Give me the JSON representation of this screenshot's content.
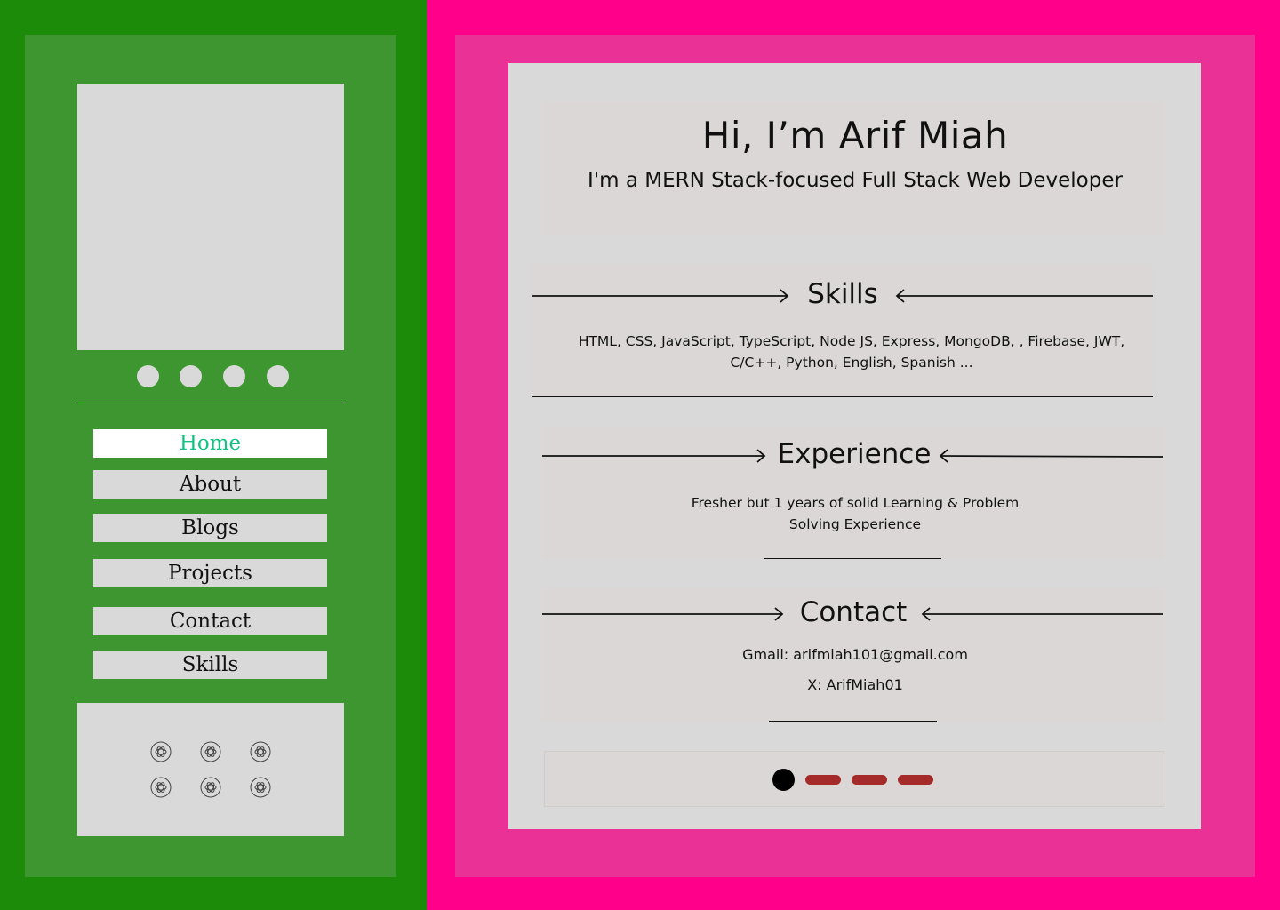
{
  "sidebar": {
    "nav_items": [
      {
        "label": "Home",
        "active": true
      },
      {
        "label": "About",
        "active": false
      },
      {
        "label": "Blogs",
        "active": false
      },
      {
        "label": "Projects",
        "active": false
      },
      {
        "label": "Contact",
        "active": false
      },
      {
        "label": "Skills",
        "active": false
      }
    ],
    "social_icon": "openai-knot-icon"
  },
  "hero": {
    "title": "Hi,  I’m Arif Miah",
    "subtitle": "I'm a MERN Stack-focused Full Stack Web Developer"
  },
  "skills": {
    "title": "Skills",
    "text_line1": "HTML, CSS, JavaScript, TypeScript, Node JS, Express, MongoDB, , Firebase, JWT,",
    "text_line2": "C/C++, Python, English, Spanish ..."
  },
  "experience": {
    "title": "Experience",
    "text_line1": "Fresher but 1 years of solid Learning & Problem",
    "text_line2": "Solving Experience"
  },
  "contact": {
    "title": "Contact",
    "gmail": "Gmail: arifmiah101@gmail.com",
    "x": "X: ArifMiah01"
  },
  "pager": {
    "pages": 4,
    "current": 1
  },
  "colors": {
    "left_bg": "#1c8b09",
    "left_panel": "#3d9630",
    "right_bg": "#ff008a",
    "right_panel": "#ea3196",
    "active_nav_text": "#13c283",
    "pager_inactive": "#a52a2a"
  }
}
